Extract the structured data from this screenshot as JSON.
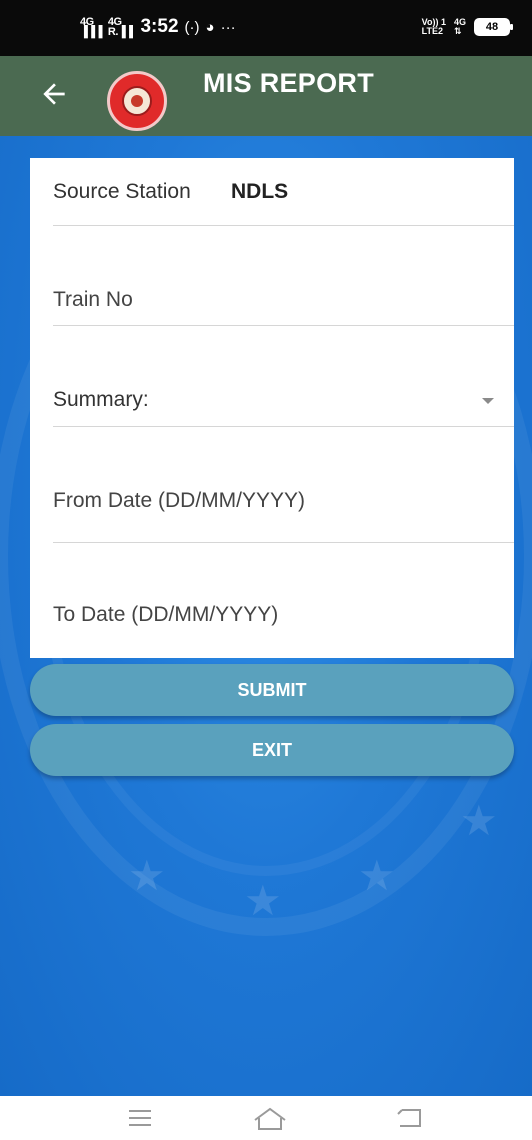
{
  "status_bar": {
    "signal1_top": "4G",
    "signal1_bottom": "▐▐▐",
    "signal2_top": "4G",
    "signal2_bottom": "R.▐▐",
    "time": "3:52",
    "icons": [
      "hotspot-icon",
      "chrome-icon",
      "more-icon"
    ],
    "volte_top": "Vo)) 1",
    "volte_bottom": "LTE2",
    "net_top": "4G",
    "net_bottom": "⇅",
    "battery": "48"
  },
  "app_bar": {
    "title": "MIS REPORT",
    "back_icon": "arrow-left-icon",
    "logo": "indian-railways-logo"
  },
  "form": {
    "source_station_label": "Source Station",
    "source_station_value": "NDLS",
    "train_no_placeholder": "Train No",
    "summary_label": "Summary:",
    "from_date_placeholder": "From Date (DD/MM/YYYY)",
    "to_date_placeholder": "To Date (DD/MM/YYYY)"
  },
  "buttons": {
    "submit_label": "SUBMIT",
    "exit_label": "EXIT"
  },
  "nav_bar": {
    "icons": [
      "menu-icon",
      "home-icon",
      "back-icon"
    ]
  },
  "colors": {
    "app_bar": "#4b6a51",
    "background": "#1f78d6",
    "button": "#5aa1bd"
  }
}
